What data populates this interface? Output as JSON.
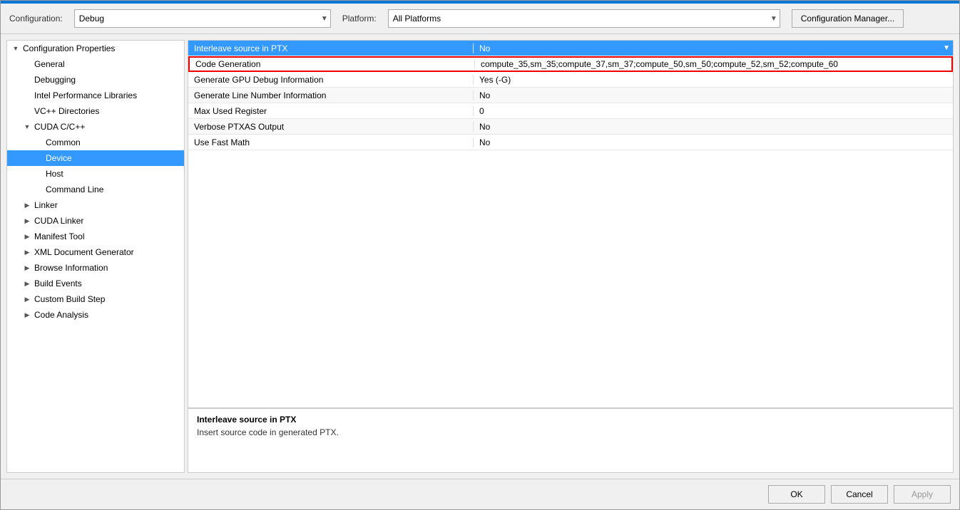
{
  "dialog": {
    "top_border_color": "#0078d7"
  },
  "toolbar": {
    "configuration_label": "Configuration:",
    "platform_label": "Platform:",
    "configuration_value": "Debug",
    "platform_value": "All Platforms",
    "config_manager_label": "Configuration Manager..."
  },
  "sidebar": {
    "items": [
      {
        "id": "config-properties",
        "label": "Configuration Properties",
        "indent": 0,
        "expanded": true,
        "has_expand": true,
        "selected": false
      },
      {
        "id": "general",
        "label": "General",
        "indent": 1,
        "expanded": false,
        "has_expand": false,
        "selected": false
      },
      {
        "id": "debugging",
        "label": "Debugging",
        "indent": 1,
        "expanded": false,
        "has_expand": false,
        "selected": false
      },
      {
        "id": "intel-perf-libs",
        "label": "Intel Performance Libraries",
        "indent": 1,
        "expanded": false,
        "has_expand": false,
        "selected": false
      },
      {
        "id": "vcpp-dirs",
        "label": "VC++ Directories",
        "indent": 1,
        "expanded": false,
        "has_expand": false,
        "selected": false
      },
      {
        "id": "cuda-cpp",
        "label": "CUDA C/C++",
        "indent": 1,
        "expanded": true,
        "has_expand": true,
        "selected": false
      },
      {
        "id": "common",
        "label": "Common",
        "indent": 2,
        "expanded": false,
        "has_expand": false,
        "selected": false
      },
      {
        "id": "device",
        "label": "Device",
        "indent": 2,
        "expanded": false,
        "has_expand": false,
        "selected": true
      },
      {
        "id": "host",
        "label": "Host",
        "indent": 2,
        "expanded": false,
        "has_expand": false,
        "selected": false
      },
      {
        "id": "command-line",
        "label": "Command Line",
        "indent": 2,
        "expanded": false,
        "has_expand": false,
        "selected": false
      },
      {
        "id": "linker",
        "label": "Linker",
        "indent": 1,
        "expanded": false,
        "has_expand": true,
        "selected": false
      },
      {
        "id": "cuda-linker",
        "label": "CUDA Linker",
        "indent": 1,
        "expanded": false,
        "has_expand": true,
        "selected": false
      },
      {
        "id": "manifest-tool",
        "label": "Manifest Tool",
        "indent": 1,
        "expanded": false,
        "has_expand": true,
        "selected": false
      },
      {
        "id": "xml-doc-gen",
        "label": "XML Document Generator",
        "indent": 1,
        "expanded": false,
        "has_expand": true,
        "selected": false
      },
      {
        "id": "browse-info",
        "label": "Browse Information",
        "indent": 1,
        "expanded": false,
        "has_expand": true,
        "selected": false
      },
      {
        "id": "build-events",
        "label": "Build Events",
        "indent": 1,
        "expanded": false,
        "has_expand": true,
        "selected": false
      },
      {
        "id": "custom-build-step",
        "label": "Custom Build Step",
        "indent": 1,
        "expanded": false,
        "has_expand": true,
        "selected": false
      },
      {
        "id": "code-analysis",
        "label": "Code Analysis",
        "indent": 1,
        "expanded": false,
        "has_expand": true,
        "selected": false
      }
    ]
  },
  "properties": {
    "rows": [
      {
        "id": "interleave-source",
        "name": "Interleave source in PTX",
        "value": "No",
        "highlighted": true,
        "has_dropdown": true,
        "code_gen": false
      },
      {
        "id": "code-generation",
        "name": "Code Generation",
        "value": "compute_35,sm_35;compute_37,sm_37;compute_50,sm_50;compute_52,sm_52;compute_60",
        "highlighted": false,
        "has_dropdown": false,
        "code_gen": true
      },
      {
        "id": "generate-gpu-debug",
        "name": "Generate GPU Debug Information",
        "value": "Yes (-G)",
        "highlighted": false,
        "has_dropdown": false,
        "code_gen": false
      },
      {
        "id": "generate-line-number",
        "name": "Generate Line Number Information",
        "value": "No",
        "highlighted": false,
        "has_dropdown": false,
        "code_gen": false
      },
      {
        "id": "max-used-register",
        "name": "Max Used Register",
        "value": "0",
        "highlighted": false,
        "has_dropdown": false,
        "code_gen": false
      },
      {
        "id": "verbose-ptxas",
        "name": "Verbose PTXAS Output",
        "value": "No",
        "highlighted": false,
        "has_dropdown": false,
        "code_gen": false
      },
      {
        "id": "use-fast-math",
        "name": "Use Fast Math",
        "value": "No",
        "highlighted": false,
        "has_dropdown": false,
        "code_gen": false
      }
    ]
  },
  "description": {
    "title": "Interleave source in PTX",
    "text": "Insert source code in generated PTX."
  },
  "buttons": {
    "ok": "OK",
    "cancel": "Cancel",
    "apply": "Apply"
  }
}
